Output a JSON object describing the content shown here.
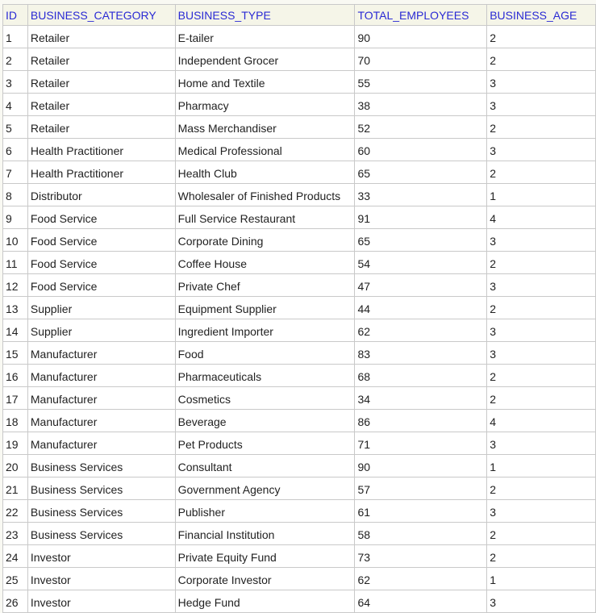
{
  "table": {
    "columns": [
      "ID",
      "BUSINESS_CATEGORY",
      "BUSINESS_TYPE",
      "TOTAL_EMPLOYEES",
      "BUSINESS_AGE"
    ],
    "rows": [
      [
        "1",
        "Retailer",
        "E-tailer",
        "90",
        "2"
      ],
      [
        "2",
        "Retailer",
        "Independent Grocer",
        "70",
        "2"
      ],
      [
        "3",
        "Retailer",
        "Home and Textile",
        "55",
        "3"
      ],
      [
        "4",
        "Retailer",
        "Pharmacy",
        "38",
        "3"
      ],
      [
        "5",
        "Retailer",
        "Mass Merchandiser",
        "52",
        "2"
      ],
      [
        "6",
        "Health Practitioner",
        "Medical Professional",
        "60",
        "3"
      ],
      [
        "7",
        "Health Practitioner",
        "Health Club",
        "65",
        "2"
      ],
      [
        "8",
        "Distributor",
        "Wholesaler of Finished Products",
        "33",
        "1"
      ],
      [
        "9",
        "Food Service",
        "Full Service Restaurant",
        "91",
        "4"
      ],
      [
        "10",
        "Food Service",
        "Corporate Dining",
        "65",
        "3"
      ],
      [
        "11",
        "Food Service",
        "Coffee House",
        "54",
        "2"
      ],
      [
        "12",
        "Food Service",
        "Private Chef",
        "47",
        "3"
      ],
      [
        "13",
        "Supplier",
        "Equipment Supplier",
        "44",
        "2"
      ],
      [
        "14",
        "Supplier",
        "Ingredient Importer",
        "62",
        "3"
      ],
      [
        "15",
        "Manufacturer",
        "Food",
        "83",
        "3"
      ],
      [
        "16",
        "Manufacturer",
        "Pharmaceuticals",
        "68",
        "2"
      ],
      [
        "17",
        "Manufacturer",
        "Cosmetics",
        "34",
        "2"
      ],
      [
        "18",
        "Manufacturer",
        "Beverage",
        "86",
        "4"
      ],
      [
        "19",
        "Manufacturer",
        "Pet Products",
        "71",
        "3"
      ],
      [
        "20",
        "Business Services",
        "Consultant",
        "90",
        "1"
      ],
      [
        "21",
        "Business Services",
        "Government Agency",
        "57",
        "2"
      ],
      [
        "22",
        "Business Services",
        "Publisher",
        "61",
        "3"
      ],
      [
        "23",
        "Business Services",
        "Financial Institution",
        "58",
        "2"
      ],
      [
        "24",
        "Investor",
        "Private Equity Fund",
        "73",
        "2"
      ],
      [
        "25",
        "Investor",
        "Corporate Investor",
        "62",
        "1"
      ],
      [
        "26",
        "Investor",
        "Hedge Fund",
        "64",
        "3"
      ]
    ]
  }
}
